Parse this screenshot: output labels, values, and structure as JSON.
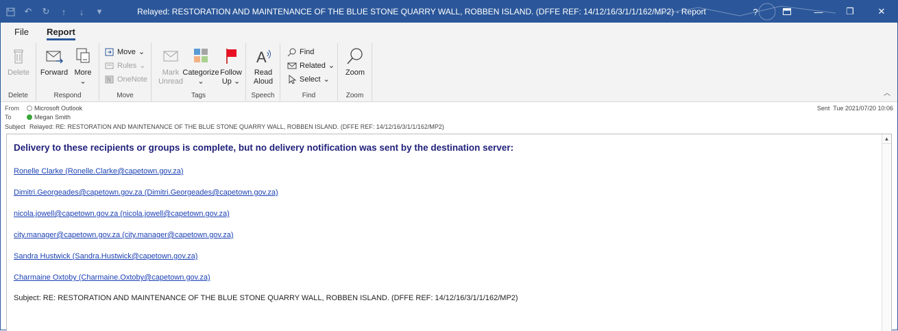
{
  "window": {
    "title": "Relayed: RESTORATION AND MAINTENANCE OF THE BLUE STONE QUARRY WALL, ROBBEN ISLAND. (DFFE REF: 14/12/16/3/1/1/162/MP2)  -  Report",
    "accent": "#2b579a",
    "controls": {
      "help": "?",
      "minimize": "—",
      "restore": "❐",
      "close": "✕"
    }
  },
  "tabs": [
    {
      "label": "File"
    },
    {
      "label": "Report"
    }
  ],
  "ribbon": {
    "groups": {
      "delete": {
        "label": "Delete",
        "buttons": {
          "delete": "Delete"
        }
      },
      "respond": {
        "label": "Respond",
        "buttons": {
          "forward": "Forward",
          "more": "More"
        }
      },
      "move": {
        "label": "Move",
        "buttons": {
          "move": "Move",
          "rules": "Rules",
          "onenote": "OneNote"
        }
      },
      "tags": {
        "label": "Tags",
        "buttons": {
          "mark_unread_1": "Mark",
          "mark_unread_2": "Unread",
          "categorize": "Categorize",
          "follow_up_1": "Follow",
          "follow_up_2": "Up"
        }
      },
      "speech": {
        "label": "Speech",
        "buttons": {
          "read_aloud_1": "Read",
          "read_aloud_2": "Aloud"
        }
      },
      "find": {
        "label": "Find",
        "buttons": {
          "find": "Find",
          "related": "Related",
          "select": "Select"
        }
      },
      "zoom": {
        "label": "Zoom",
        "buttons": {
          "zoom": "Zoom"
        }
      }
    }
  },
  "header": {
    "from_label": "From",
    "from_value": "Microsoft Outlook",
    "to_label": "To",
    "to_value": "Megan Smith",
    "subject_label": "Subject",
    "subject_value": "Relayed: RE: RESTORATION AND MAINTENANCE OF THE BLUE STONE QUARRY WALL, ROBBEN ISLAND. (DFFE REF: 14/12/16/3/1/1/162/MP2)",
    "sent_label": "Sent",
    "sent_value": "Tue 2021/07/20 10:06"
  },
  "body": {
    "heading": "Delivery to these recipients or groups is complete, but no delivery notification was sent by the destination server:",
    "recipients": [
      "Ronelle Clarke (Ronelle.Clarke@capetown.gov.za)",
      "Dimitri.Georgeades@capetown.gov.za (Dimitri.Georgeades@capetown.gov.za)",
      "nicola.jowell@capetown.gov.za (nicola.jowell@capetown.gov.za)",
      "city.manager@capetown.gov.za (city.manager@capetown.gov.za)",
      "Sandra Hustwick (Sandra.Hustwick@capetown.gov.za)",
      "Charmaine Oxtoby (Charmaine.Oxtoby@capetown.gov.za)"
    ],
    "subject_line": "Subject: RE: RESTORATION AND MAINTENANCE OF THE BLUE STONE QUARRY WALL, ROBBEN ISLAND. (DFFE REF: 14/12/16/3/1/1/162/MP2)"
  }
}
